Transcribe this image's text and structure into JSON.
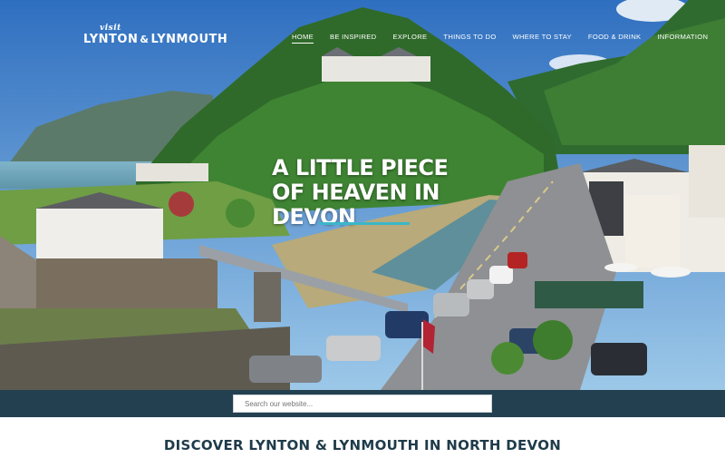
{
  "brand": {
    "visit": "visit",
    "name_left": "LYNTON",
    "amp": "&",
    "name_right": "LYNMOUTH"
  },
  "nav": {
    "items": [
      {
        "label": "HOME",
        "active": true
      },
      {
        "label": "BE INSPIRED",
        "active": false
      },
      {
        "label": "EXPLORE",
        "active": false
      },
      {
        "label": "THINGS TO DO",
        "active": false
      },
      {
        "label": "WHERE TO STAY",
        "active": false
      },
      {
        "label": "FOOD & DRINK",
        "active": false
      },
      {
        "label": "INFORMATION",
        "active": false
      }
    ]
  },
  "hero": {
    "headline": "A LITTLE PIECE OF HEAVEN IN DEVON",
    "accent_color": "#3bb7c9"
  },
  "search": {
    "placeholder": "Search our website..."
  },
  "main": {
    "heading": "DISCOVER LYNTON & LYNMOUTH IN NORTH DEVON"
  },
  "colors": {
    "band": "#234050",
    "heading": "#1f3b4a"
  }
}
